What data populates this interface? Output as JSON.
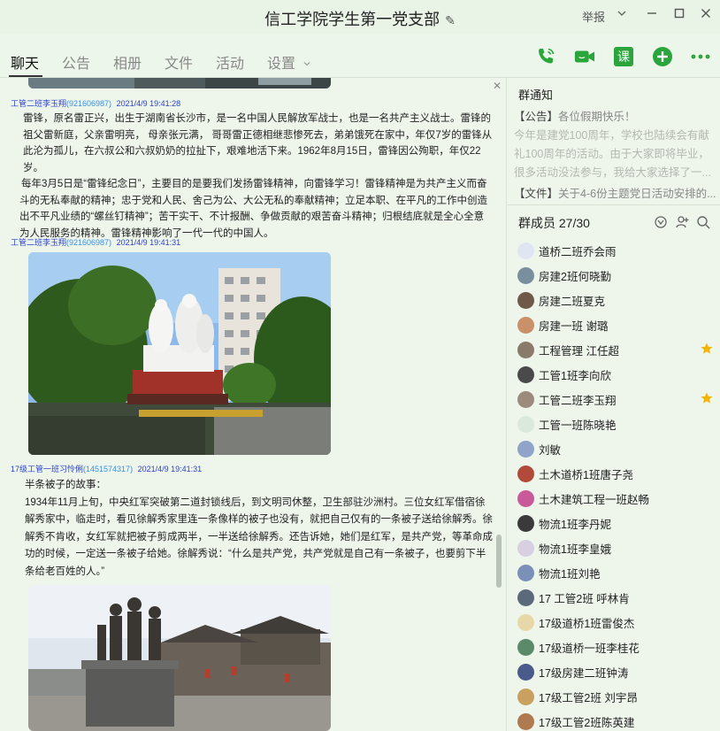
{
  "window": {
    "title": "信工学院学生第一党支部",
    "report_label": "举报"
  },
  "tabs": [
    "聊天",
    "公告",
    "相册",
    "文件",
    "活动",
    "设置"
  ],
  "toolbar": {
    "icons": [
      "phone-call-icon",
      "video-call-icon",
      "course-icon",
      "add-icon",
      "more-icon"
    ],
    "course_label": "课",
    "accent_color": "#2aa53b"
  },
  "chat": {
    "messages": [
      {
        "sender": "工管二班李玉翔",
        "qq": "(921606987)",
        "time": "2021/4/9 19:41:28",
        "paragraphs": [
          "雷锋，原名雷正兴，出生于湖南省长沙市，是一名中国人民解放军战士，也是一名共产主义战士。雷锋的祖父雷新庭，父亲雷明亮， 母亲张元满， 哥哥雷正德相继悲惨死去，弟弟饿死在家中，年仅7岁的雷锋从此沦为孤儿，在六叔公和六叔奶奶的拉扯下，艰难地活下来。1962年8月15日，雷锋因公殉职，年仅22岁。",
          "每年3月5日是“雷锋纪念日”，主要目的是要我们发扬雷锋精神，向雷锋学习！雷锋精神是为共产主义而奋斗的无私奉献的精神；忠于党和人民、舍己为公、大公无私的奉献精神；立足本职、在平凡的工作中创造出不平凡业绩的“螺丝钉精神”；苦干实干、不计报酬、争做贡献的艰苦奋斗精神；归根结底就是全心全意为人民服务的精神。雷锋精神影响了一代一代的中国人。"
        ]
      },
      {
        "sender": "工管二班李玉翔",
        "qq": "(921606987)",
        "time": "2021/4/9 19:41:31"
      },
      {
        "sender": "17级工管一班习怜俐",
        "qq": "(1451574317)",
        "time": "2021/4/9 19:41:31",
        "paragraphs": [
          "半条被子的故事：",
          "1934年11月上旬，中央红军突破第二道封锁线后，到文明司休整，卫生部驻沙洲村。三位女红军借宿徐解秀家中，临走时，看见徐解秀家里连一条像样的被子也没有，就把自己仅有的一条被子送给徐解秀。徐解秀不肯收，女红军就把被子剪成两半，一半送给徐解秀。还告诉她，她们是红军，是共产党，等革命成功的时候，一定送一条被子给她。徐解秀说：“什么是共产党，共产党就是自己有一条被子，也要剪下半条给老百姓的人。”"
        ]
      }
    ]
  },
  "side": {
    "notice_title": "群通知",
    "notice_lines": [
      {
        "tag": "【公告】",
        "text": "各位假期快乐！"
      },
      {
        "tag": "",
        "text": "今年是建党100周年，学校也陆续会有献"
      },
      {
        "tag": "",
        "text": "礼100周年的活动。由于大家即将毕业，"
      },
      {
        "tag": "",
        "text": "很多活动没法参与，我给大家选择了一..."
      }
    ],
    "file_tag": "【文件】",
    "file_text": "关于4-6份主题党日活动安排的...",
    "members_title": "群成员 27/30",
    "members": [
      {
        "name": "道桥二班乔会雨",
        "color": "#dfe6f2",
        "star": false
      },
      {
        "name": "房建2班何晓勤",
        "color": "#7a8f9e",
        "star": false
      },
      {
        "name": "房建二班夏克",
        "color": "#6f5a4a",
        "star": false
      },
      {
        "name": "房建一班 谢璐",
        "color": "#c9906a",
        "star": false
      },
      {
        "name": "工程管理 江任超",
        "color": "#8a7a6a",
        "star": true
      },
      {
        "name": "工管1班李向欣",
        "color": "#4a4a4a",
        "star": false
      },
      {
        "name": "工管二班李玉翔",
        "color": "#9c8b7c",
        "star": true
      },
      {
        "name": "工管一班陈晓艳",
        "color": "#d9eadb",
        "star": false
      },
      {
        "name": "刘敏",
        "color": "#8fa4c8",
        "star": false
      },
      {
        "name": "土木道桥1班唐子尧",
        "color": "#b24a3a",
        "star": false
      },
      {
        "name": "土木建筑工程一班赵畅",
        "color": "#c85a9a",
        "star": false
      },
      {
        "name": "物流1班李丹妮",
        "color": "#3a3a3a",
        "star": false
      },
      {
        "name": "物流1班李皇娥",
        "color": "#d8d0e0",
        "star": false
      },
      {
        "name": "物流1班刘艳",
        "color": "#7a90b8",
        "star": false
      },
      {
        "name": "17 工管2班 呼林肯",
        "color": "#5a6a7a",
        "star": false
      },
      {
        "name": "17级道桥1班雷俊杰",
        "color": "#e8d8a8",
        "star": false
      },
      {
        "name": "17级道桥一班李桂花",
        "color": "#5a8a6a",
        "star": false
      },
      {
        "name": "17级房建二班钟涛",
        "color": "#4a5a8a",
        "star": false
      },
      {
        "name": "17级工管2班 刘宇昂",
        "color": "#c8a060",
        "star": false
      },
      {
        "name": "17级工管2班陈英建",
        "color": "#b07a50",
        "star": false
      }
    ],
    "star_color": "#f5b400"
  }
}
